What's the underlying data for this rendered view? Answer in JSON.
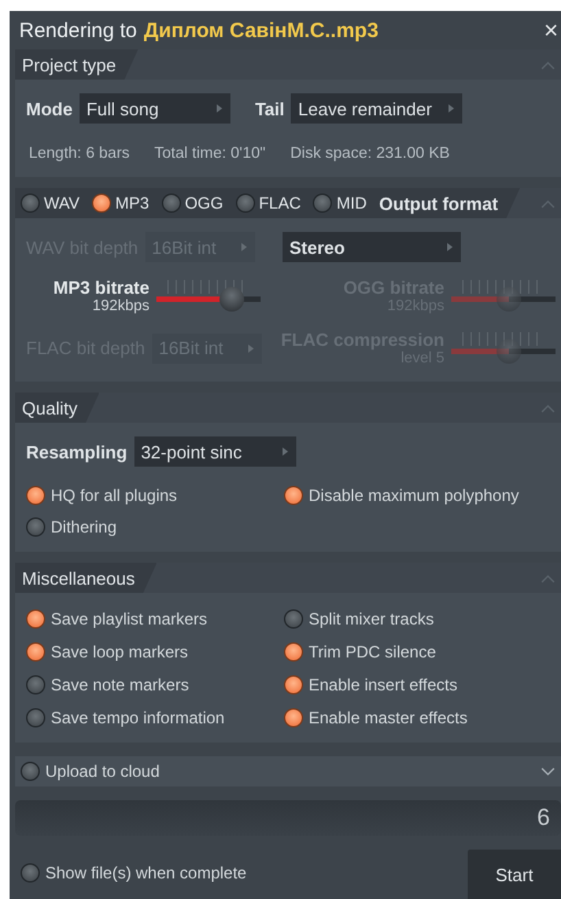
{
  "window": {
    "title": "Rendering to",
    "file_name": "Диплом СавінМ.С..mp3",
    "close": "×"
  },
  "project_type": {
    "title": "Project type",
    "expanded": true,
    "fields": [
      {
        "label": "Mode",
        "value": "Full song"
      },
      {
        "label": "Tail",
        "value": "Leave remainder"
      }
    ],
    "info": [
      "Length: 6 bars",
      "Total time: 0'10\"",
      "Disk space: 231.00 KB"
    ]
  },
  "output_format": {
    "title": "Output format",
    "expanded": true,
    "formats": [
      {
        "label": "WAV",
        "selected": false
      },
      {
        "label": "MP3",
        "selected": true
      },
      {
        "label": "OGG",
        "selected": false
      },
      {
        "label": "FLAC",
        "selected": false
      },
      {
        "label": "MID",
        "selected": false
      }
    ],
    "controls": [
      {
        "kind": "select",
        "label": "WAV bit depth",
        "value": "16Bit int",
        "disabled": true
      },
      {
        "kind": "select",
        "value": "Stereo",
        "disabled": false
      },
      {
        "kind": "slider",
        "label": "MP3 bitrate",
        "reading": "192kbps",
        "level": 0.72,
        "disabled": false
      },
      {
        "kind": "slider",
        "label": "OGG bitrate",
        "reading": "192kbps",
        "level": 0.55,
        "disabled": true
      },
      {
        "kind": "select",
        "label": "FLAC bit depth",
        "value": "16Bit int",
        "disabled": true
      },
      {
        "kind": "slider",
        "label": "FLAC compression",
        "reading": "level 5",
        "level": 0.55,
        "disabled": true
      }
    ]
  },
  "quality": {
    "title": "Quality",
    "expanded": true,
    "resampling": {
      "label": "Resampling",
      "value": "32-point sinc"
    },
    "options": [
      {
        "label": "HQ for all plugins",
        "checked": true
      },
      {
        "label": "Disable maximum polyphony",
        "checked": true
      },
      {
        "label": "Dithering",
        "checked": false
      }
    ]
  },
  "miscellaneous": {
    "title": "Miscellaneous",
    "expanded": true,
    "options": [
      {
        "label": "Save playlist markers",
        "checked": true
      },
      {
        "label": "Split mixer tracks",
        "checked": false
      },
      {
        "label": "Save loop markers",
        "checked": true
      },
      {
        "label": "Trim PDC silence",
        "checked": true
      },
      {
        "label": "Save note markers",
        "checked": false
      },
      {
        "label": "Enable insert effects",
        "checked": true
      },
      {
        "label": "Save tempo information",
        "checked": false
      },
      {
        "label": "Enable master effects",
        "checked": true
      }
    ]
  },
  "upload": {
    "label": "Upload to cloud",
    "checked": false,
    "expanded": false
  },
  "progress": {
    "count": "6",
    "level": 0
  },
  "show_files": {
    "label": "Show file(s) when complete",
    "checked": false
  },
  "start_button": "Start"
}
